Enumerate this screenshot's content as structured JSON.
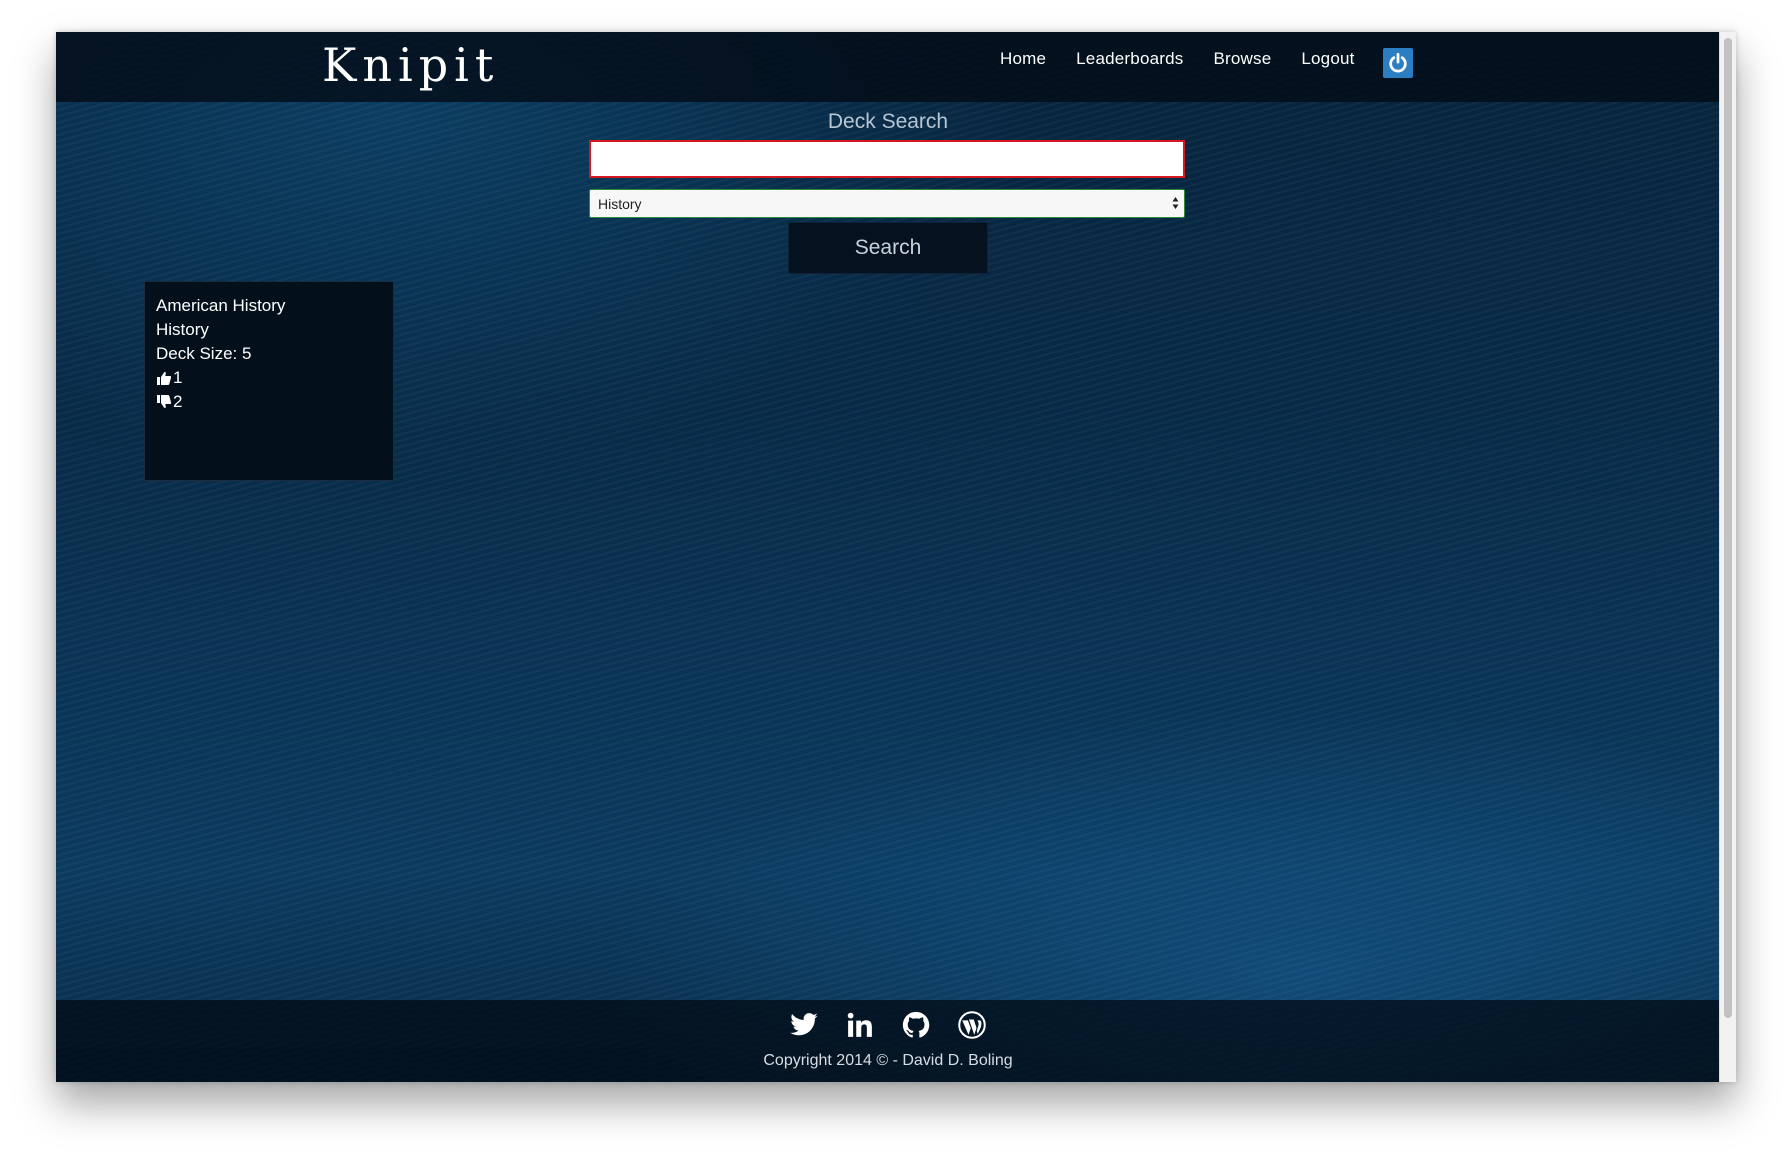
{
  "header": {
    "brand": "Knipit",
    "nav": [
      {
        "label": "Home"
      },
      {
        "label": "Leaderboards"
      },
      {
        "label": "Browse"
      },
      {
        "label": "Logout"
      }
    ],
    "power_icon": "power-icon"
  },
  "search": {
    "title": "Deck Search",
    "query_value": "",
    "category_selected": "History",
    "button_label": "Search"
  },
  "results": [
    {
      "name": "American History",
      "category": "History",
      "size_label": "Deck Size: 5",
      "upvotes": "1",
      "downvotes": "2"
    }
  ],
  "footer": {
    "social_icons": [
      "twitter-icon",
      "linkedin-icon",
      "github-icon",
      "wordpress-icon"
    ],
    "copyright": "Copyright 2014 © - David D. Boling"
  },
  "colors": {
    "accent": "#2b7ec1",
    "input_border": "#d4181f",
    "select_border": "#2e8a3a"
  }
}
